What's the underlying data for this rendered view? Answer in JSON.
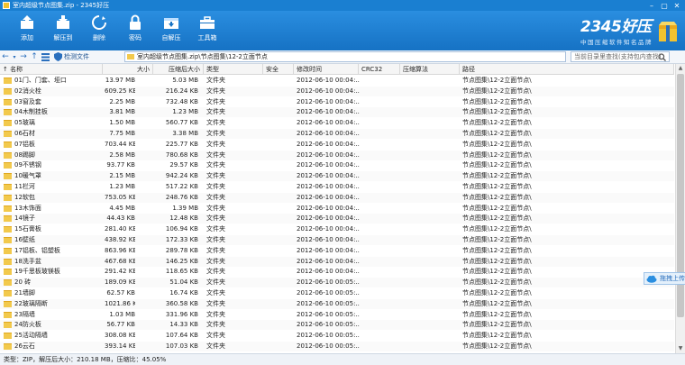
{
  "window": {
    "title": "室内超级节点图集.zip - 2345好压",
    "controls": [
      "–",
      "▢",
      "✕"
    ]
  },
  "toolbar": {
    "items": [
      {
        "label": "添加",
        "icon": "add-icon"
      },
      {
        "label": "解压到",
        "icon": "extract-icon"
      },
      {
        "label": "删除",
        "icon": "delete-icon"
      },
      {
        "label": "密码",
        "icon": "password-icon"
      },
      {
        "label": "自解压",
        "icon": "self-extract-icon"
      },
      {
        "label": "工具箱",
        "icon": "toolbox-icon"
      }
    ]
  },
  "brand": {
    "logo": "2345好压",
    "slogan": "中国压缩软件知名品牌"
  },
  "nav": {
    "detect_label": "检测文件",
    "path": "室内超级节点图集.zip\\节点图集\\12-2立面节点",
    "search_placeholder": "当前目录里查找(支持包内查找)"
  },
  "columns": [
    "名称",
    "大小",
    "压缩后大小",
    "类型",
    "安全",
    "修改时间",
    "CRC32",
    "压缩算法",
    "路径"
  ],
  "rows": [
    {
      "name": "01门、门套、垭口",
      "size": "13.97 MB",
      "csize": "5.03 MB",
      "type": "文件夹",
      "modified": "2012-06-10 00:04:...",
      "path": "节点图集\\12-2立面节点\\"
    },
    {
      "name": "02消火栓",
      "size": "609.25 KB",
      "csize": "216.24 KB",
      "type": "文件夹",
      "modified": "2012-06-10 00:04:...",
      "path": "节点图集\\12-2立面节点\\"
    },
    {
      "name": "03窗及套",
      "size": "2.25 MB",
      "csize": "732.48 KB",
      "type": "文件夹",
      "modified": "2012-06-10 00:04:...",
      "path": "节点图集\\12-2立面节点\\"
    },
    {
      "name": "04木制挂板",
      "size": "3.81 MB",
      "csize": "1.23 MB",
      "type": "文件夹",
      "modified": "2012-06-10 00:04:...",
      "path": "节点图集\\12-2立面节点\\"
    },
    {
      "name": "05玻璃",
      "size": "1.50 MB",
      "csize": "560.77 KB",
      "type": "文件夹",
      "modified": "2012-06-10 00:04:...",
      "path": "节点图集\\12-2立面节点\\"
    },
    {
      "name": "06石材",
      "size": "7.75 MB",
      "csize": "3.38 MB",
      "type": "文件夹",
      "modified": "2012-06-10 00:04:...",
      "path": "节点图集\\12-2立面节点\\"
    },
    {
      "name": "07铝板",
      "size": "703.44 KB",
      "csize": "225.77 KB",
      "type": "文件夹",
      "modified": "2012-06-10 00:04:...",
      "path": "节点图集\\12-2立面节点\\"
    },
    {
      "name": "08踢脚",
      "size": "2.58 MB",
      "csize": "780.68 KB",
      "type": "文件夹",
      "modified": "2012-06-10 00:04:...",
      "path": "节点图集\\12-2立面节点\\"
    },
    {
      "name": "09不锈钢",
      "size": "93.77 KB",
      "csize": "29.57 KB",
      "type": "文件夹",
      "modified": "2012-06-10 00:04:...",
      "path": "节点图集\\12-2立面节点\\"
    },
    {
      "name": "10暖气罩",
      "size": "2.15 MB",
      "csize": "942.24 KB",
      "type": "文件夹",
      "modified": "2012-06-10 00:04:...",
      "path": "节点图集\\12-2立面节点\\"
    },
    {
      "name": "11栏河",
      "size": "1.23 MB",
      "csize": "517.22 KB",
      "type": "文件夹",
      "modified": "2012-06-10 00:04:...",
      "path": "节点图集\\12-2立面节点\\"
    },
    {
      "name": "12软包",
      "size": "753.05 KB",
      "csize": "248.76 KB",
      "type": "文件夹",
      "modified": "2012-06-10 00:04:...",
      "path": "节点图集\\12-2立面节点\\"
    },
    {
      "name": "13木饰面",
      "size": "4.45 MB",
      "csize": "1.39 MB",
      "type": "文件夹",
      "modified": "2012-06-10 00:04:...",
      "path": "节点图集\\12-2立面节点\\"
    },
    {
      "name": "14镜子",
      "size": "44.43 KB",
      "csize": "12.48 KB",
      "type": "文件夹",
      "modified": "2012-06-10 00:04:...",
      "path": "节点图集\\12-2立面节点\\"
    },
    {
      "name": "15石膏板",
      "size": "281.40 KB",
      "csize": "106.94 KB",
      "type": "文件夹",
      "modified": "2012-06-10 00:04:...",
      "path": "节点图集\\12-2立面节点\\"
    },
    {
      "name": "16壁纸",
      "size": "438.92 KB",
      "csize": "172.33 KB",
      "type": "文件夹",
      "modified": "2012-06-10 00:04:...",
      "path": "节点图集\\12-2立面节点\\"
    },
    {
      "name": "17铝板、铝塑板",
      "size": "863.96 KB",
      "csize": "289.78 KB",
      "type": "文件夹",
      "modified": "2012-06-10 00:04:...",
      "path": "节点图集\\12-2立面节点\\"
    },
    {
      "name": "18洗手盆",
      "size": "467.68 KB",
      "csize": "146.25 KB",
      "type": "文件夹",
      "modified": "2012-06-10 00:04:...",
      "path": "节点图集\\12-2立面节点\\"
    },
    {
      "name": "19千思板玻镁板",
      "size": "291.42 KB",
      "csize": "118.65 KB",
      "type": "文件夹",
      "modified": "2012-06-10 00:04:...",
      "path": "节点图集\\12-2立面节点\\"
    },
    {
      "name": "20 砖",
      "size": "189.09 KB",
      "csize": "51.04 KB",
      "type": "文件夹",
      "modified": "2012-06-10 00:05:...",
      "path": "节点图集\\12-2立面节点\\"
    },
    {
      "name": "21墙脚",
      "size": "62.57 KB",
      "csize": "16.74 KB",
      "type": "文件夹",
      "modified": "2012-06-10 00:05:...",
      "path": "节点图集\\12-2立面节点\\"
    },
    {
      "name": "22玻璃隔断",
      "size": "1021.86 KB",
      "csize": "360.58 KB",
      "type": "文件夹",
      "modified": "2012-06-10 00:05:...",
      "path": "节点图集\\12-2立面节点\\"
    },
    {
      "name": "23隔墙",
      "size": "1.03 MB",
      "csize": "331.96 KB",
      "type": "文件夹",
      "modified": "2012-06-10 00:05:...",
      "path": "节点图集\\12-2立面节点\\"
    },
    {
      "name": "24防火板",
      "size": "56.77 KB",
      "csize": "14.33 KB",
      "type": "文件夹",
      "modified": "2012-06-10 00:05:...",
      "path": "节点图集\\12-2立面节点\\"
    },
    {
      "name": "25活动隔墙",
      "size": "308.08 KB",
      "csize": "107.64 KB",
      "type": "文件夹",
      "modified": "2012-06-10 00:05:...",
      "path": "节点图集\\12-2立面节点\\"
    },
    {
      "name": "26云石",
      "size": "393.14 KB",
      "csize": "107.03 KB",
      "type": "文件夹",
      "modified": "2012-06-10 00:05:...",
      "path": "节点图集\\12-2立面节点\\"
    }
  ],
  "status": "类型：ZIP，解压后大小：210.18 MB，压缩比：45.05%",
  "float_button": "拖拽上传",
  "colors": {
    "accent": "#1a7fd1",
    "folder": "#f2c94c"
  }
}
